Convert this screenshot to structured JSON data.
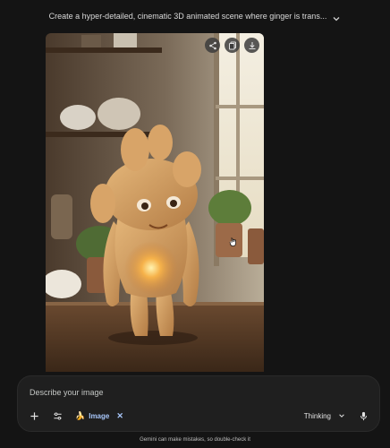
{
  "header": {
    "title": "Create a hyper-detailed, cinematic 3D animated scene where ginger is trans...",
    "expand_icon": "chevron-down-icon"
  },
  "image_actions": {
    "share_icon": "share-icon",
    "copy_icon": "copy-icon",
    "download_icon": "download-icon"
  },
  "composer": {
    "placeholder": "Describe your image",
    "add_icon": "plus-icon",
    "tools_icon": "tools-sliders-icon",
    "chip": {
      "emoji": "🍌",
      "label": "Image",
      "remove_label": "✕"
    },
    "mode_label": "Thinking",
    "mic_icon": "mic-icon"
  },
  "footer": {
    "disclaimer": "Gemini can make mistakes, so double-check it"
  },
  "colors": {
    "background": "#141414",
    "composer_bg": "#1f1f1f",
    "chip_text": "#a8c7fa"
  }
}
